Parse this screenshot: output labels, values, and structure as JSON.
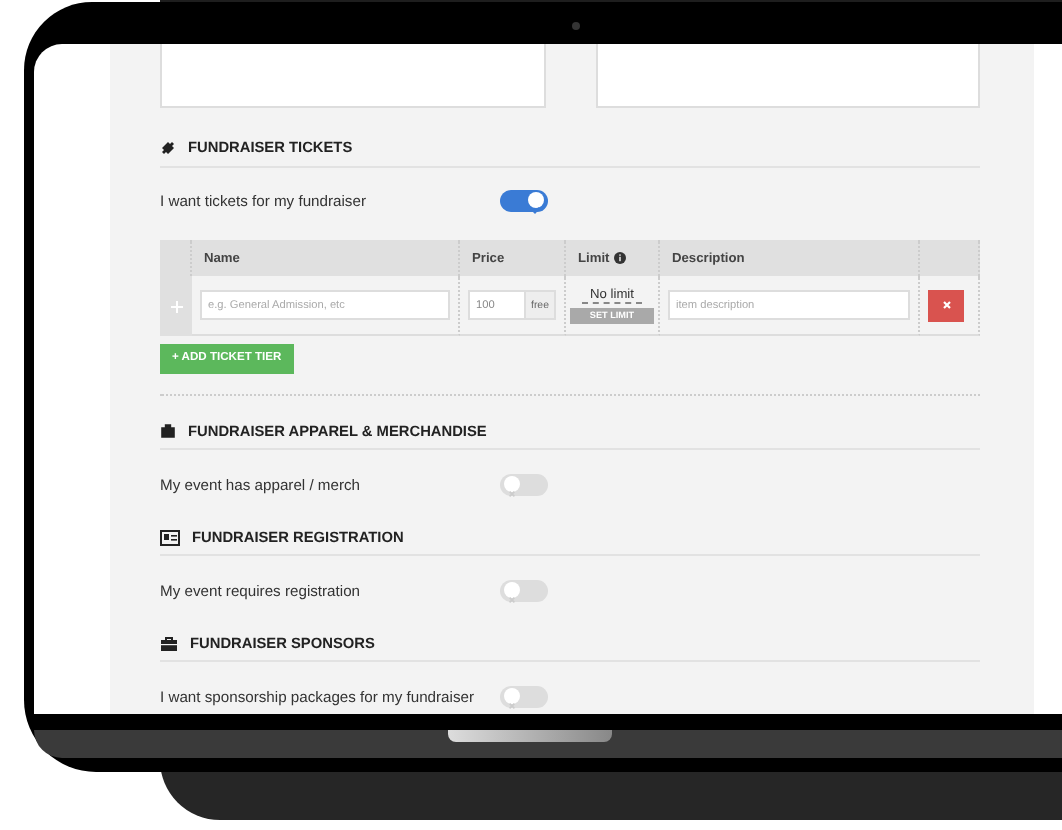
{
  "sections": [
    {
      "title": "FUNDRAISER TICKETS",
      "toggle_label": "I want tickets for my fundraiser",
      "on": true,
      "table": {
        "columns": [
          {
            "label": "Name",
            "help": false
          },
          {
            "label": "Price",
            "help": false
          },
          {
            "label": "Limit",
            "help": true
          },
          {
            "label": "Description",
            "help": false
          }
        ],
        "rows": [
          {
            "name_placeholder": "e.g. General Admission, etc",
            "price_placeholder": "100",
            "price_addon": "free",
            "limit": "No limit",
            "limit_button": "SET LIMIT",
            "description_placeholder": "item description"
          }
        ]
      },
      "add_button": "+ ADD TICKET TIER"
    },
    {
      "title": "FUNDRAISER APPAREL & MERCHANDISE",
      "toggle_label": "My event has apparel / merch",
      "on": false
    },
    {
      "title": "FUNDRAISER REGISTRATION",
      "toggle_label": "My event requires registration",
      "on": false
    },
    {
      "title": "FUNDRAISER SPONSORS",
      "toggle_label": "I want sponsorship packages for my fundraiser",
      "on": false
    }
  ]
}
